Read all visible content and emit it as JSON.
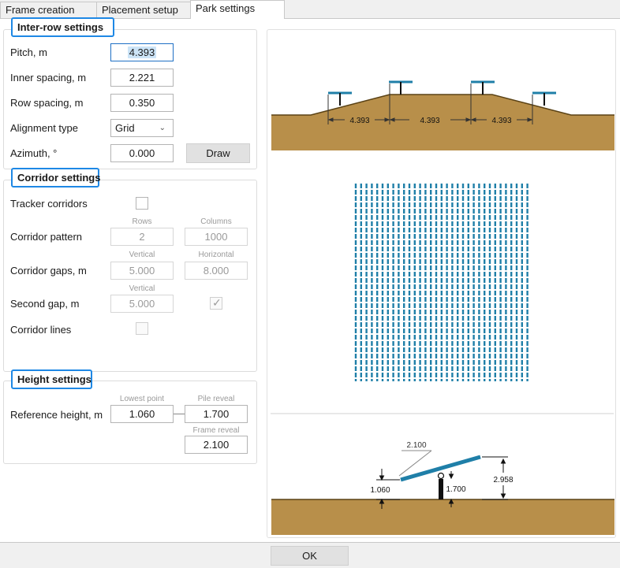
{
  "tabs": [
    {
      "label": "Frame creation"
    },
    {
      "label": "Placement setup"
    },
    {
      "label": "Park settings"
    }
  ],
  "inter_row": {
    "title": "Inter-row settings",
    "pitch_label": "Pitch, m",
    "pitch_value": "4.393",
    "inner_spacing_label": "Inner spacing, m",
    "inner_spacing_value": "2.221",
    "row_spacing_label": "Row spacing, m",
    "row_spacing_value": "0.350",
    "alignment_label": "Alignment type",
    "alignment_value": "Grid",
    "azimuth_label": "Azimuth, °",
    "azimuth_value": "0.000",
    "draw_label": "Draw"
  },
  "corridor": {
    "title": "Corridor settings",
    "tracker_corridors_label": "Tracker corridors",
    "tracker_corridors_checked": false,
    "pattern_label": "Corridor pattern",
    "rows_label": "Rows",
    "rows_value": "2",
    "columns_label": "Columns",
    "columns_value": "1000",
    "gaps_label": "Corridor gaps, m",
    "vertical_label": "Vertical",
    "vertical_value": "5.000",
    "horizontal_label": "Horizontal",
    "horizontal_value": "8.000",
    "second_gap_label": "Second gap, m",
    "second_vertical_label": "Vertical",
    "second_gap_value": "5.000",
    "second_gap_checked": true,
    "lines_label": "Corridor lines",
    "lines_checked": false
  },
  "height": {
    "title": "Height settings",
    "reference_label": "Reference height, m",
    "lowest_point_label": "Lowest point",
    "lowest_point_value": "1.060",
    "pile_reveal_label": "Pile reveal",
    "pile_reveal_value": "1.700",
    "frame_reveal_label": "Frame reveal",
    "frame_reveal_value": "2.100"
  },
  "preview": {
    "top_dims": [
      "4.393",
      "4.393",
      "4.393"
    ],
    "tracker_rows_visible": 33,
    "side_dims": {
      "frame": "2.100",
      "lowest": "1.060",
      "pile": "1.700",
      "total": "2.958"
    }
  },
  "colors": {
    "ground": "#b88f4a",
    "ground_line": "#5a4215",
    "tracker": "#1f7fa8",
    "accent": "#1e88e5"
  },
  "ok_label": "OK"
}
